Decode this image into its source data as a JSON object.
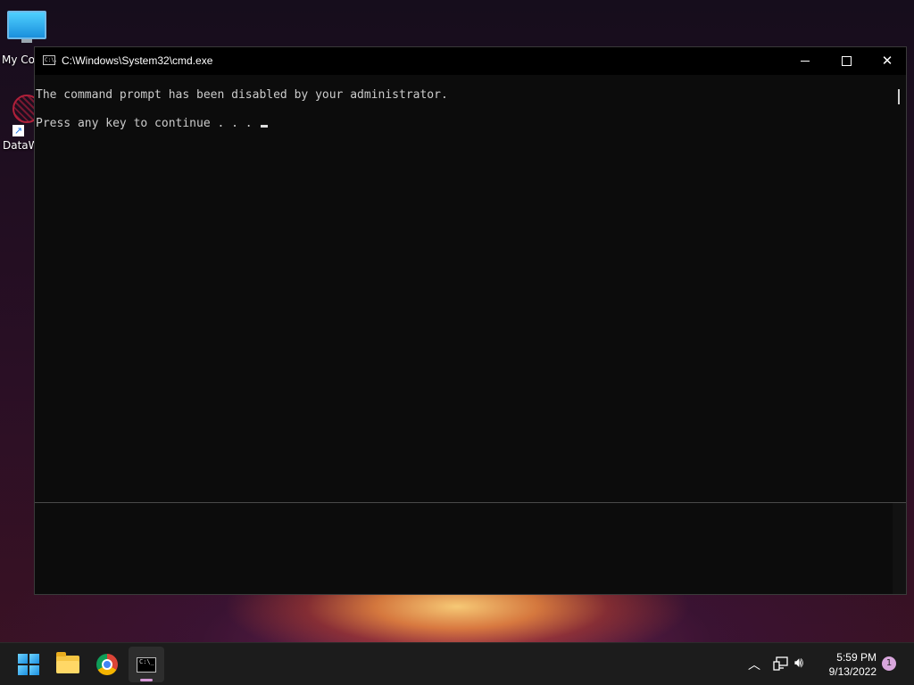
{
  "desktop": {
    "icons": [
      {
        "label": "My Co",
        "icon": "computer-icon"
      },
      {
        "label": "DataW",
        "icon": "datawarrior-icon"
      }
    ]
  },
  "cmd_window": {
    "title": "C:\\Windows\\System32\\cmd.exe",
    "icon_text": "C:\\.",
    "controls": {
      "minimize": "minimize-icon",
      "maximize": "maximize-icon",
      "close": "close-icon"
    },
    "lines": [
      "The command prompt has been disabled by your administrator.",
      "Press any key to continue . . . "
    ]
  },
  "taskbar": {
    "pinned": [
      "start-icon",
      "file-explorer-icon",
      "chrome-icon",
      "cmd-icon"
    ],
    "cmd_icon_text": "C:\\_",
    "clock": {
      "time": "5:59 PM",
      "date": "9/13/2022"
    },
    "notification_count": "1",
    "colors": {
      "accent": "#d79ad8",
      "taskbar_bg": "#1c1c1c",
      "console_bg": "#0c0c0c",
      "console_text": "#cccccc"
    }
  }
}
